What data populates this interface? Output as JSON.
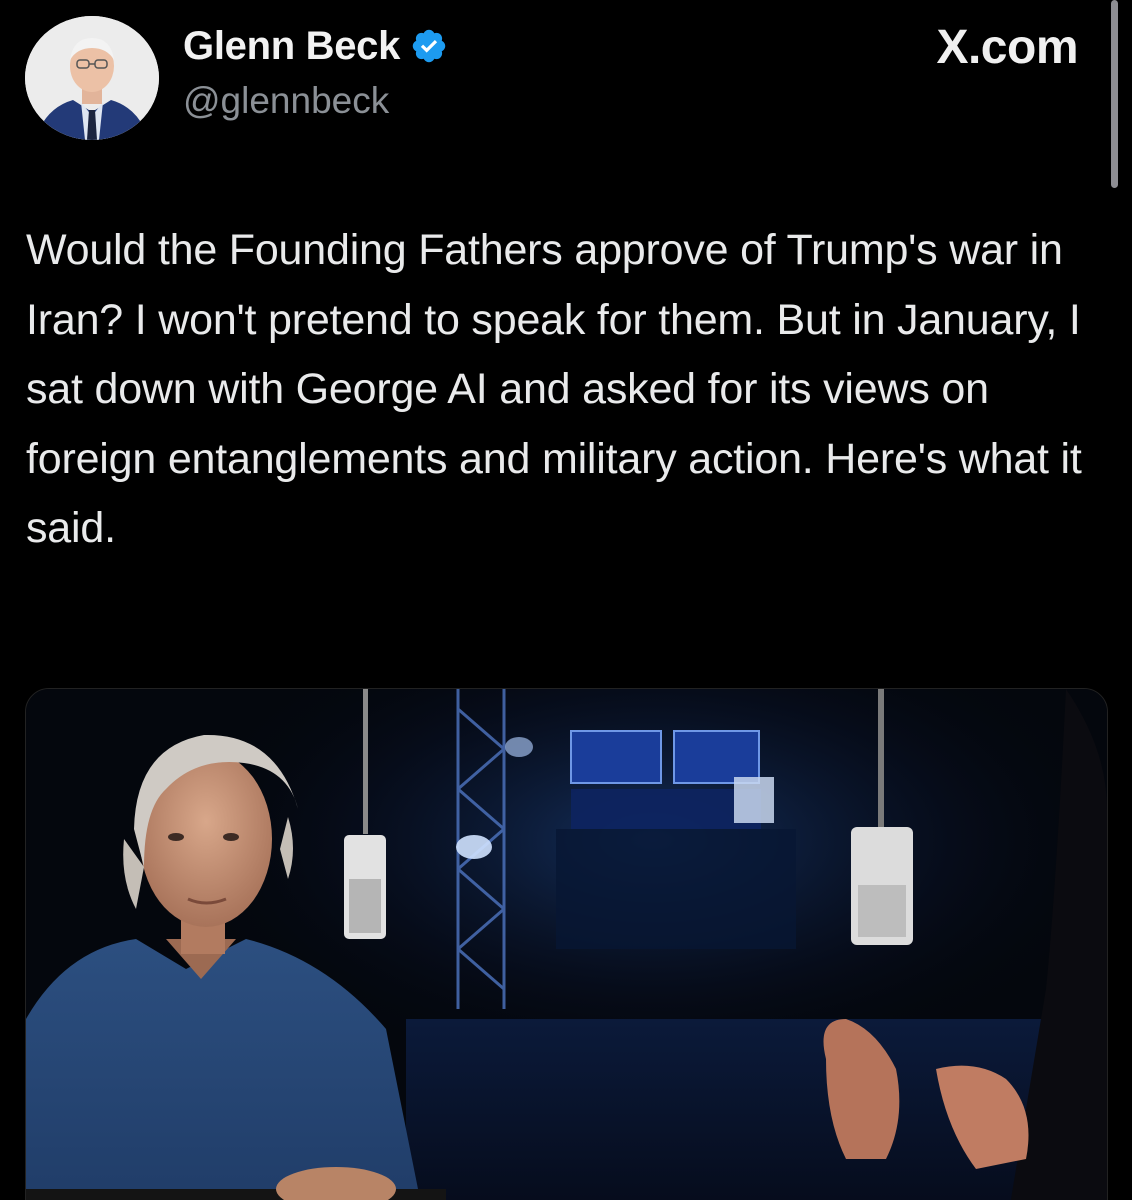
{
  "author": {
    "display_name": "Glenn Beck",
    "handle": "@glennbeck",
    "verified": true,
    "avatar_icon": "profile-photo",
    "verified_icon": "verified-badge-icon",
    "verified_color": "#1d9bf0"
  },
  "brand": {
    "label": "X.com"
  },
  "tweet": {
    "text": "Would the Founding Fathers approve of Trump's war in Iran? I won't pretend to speak for them. But in January, I sat down with George AI and asked for its views on foreign entanglements and military action. Here's what it said."
  },
  "media": {
    "type": "video-thumbnail"
  },
  "colors": {
    "background": "#000000",
    "text": "#e7e9ea",
    "secondary_text": "#8b9096",
    "accent": "#1d9bf0"
  }
}
